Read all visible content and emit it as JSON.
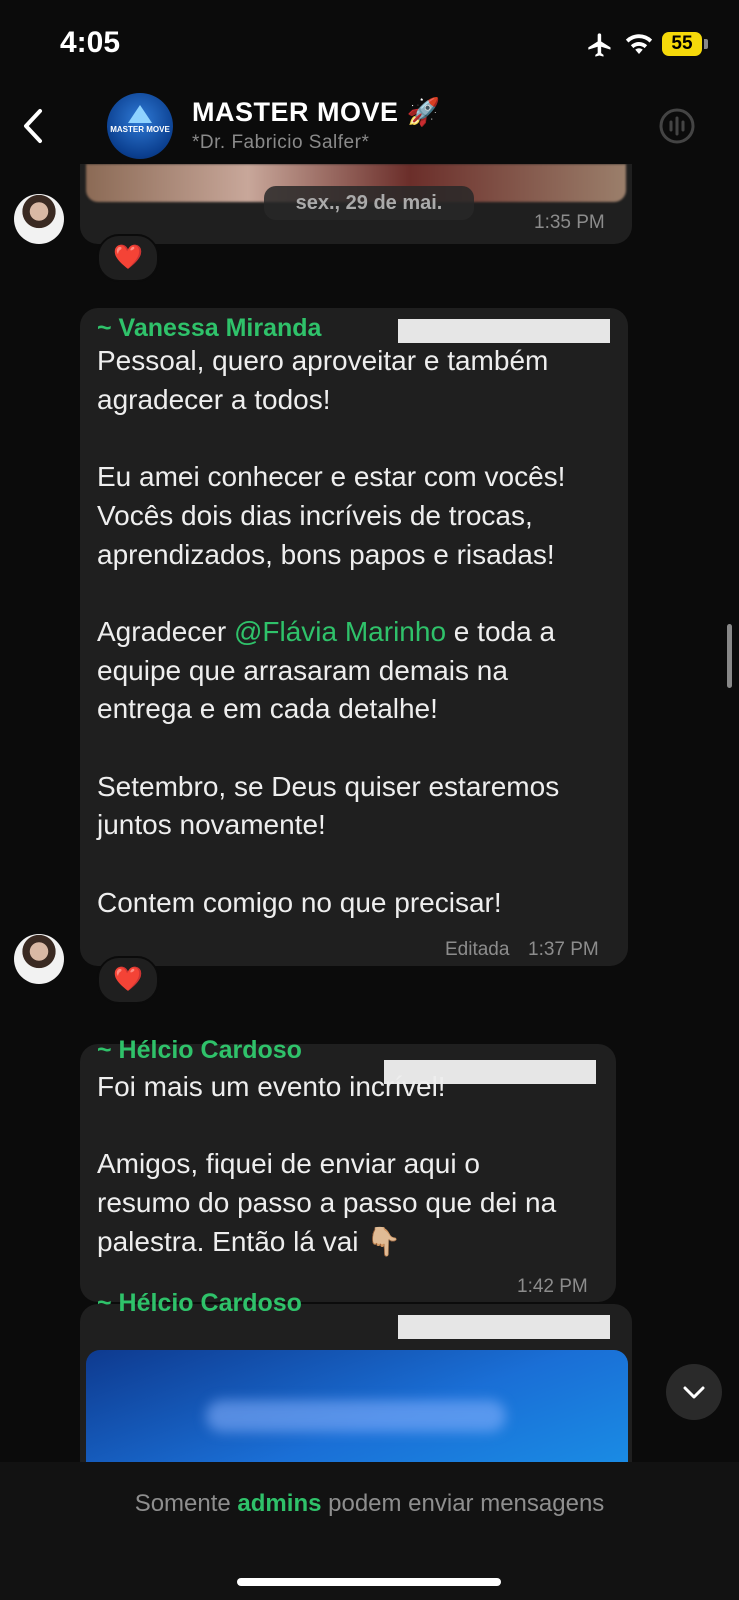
{
  "status_bar": {
    "time": "4:05",
    "battery": "55"
  },
  "header": {
    "title": "MASTER MOVE 🚀",
    "subtitle": "*Dr. Fabricio Salfer*",
    "avatar_text": "MASTER MOVE"
  },
  "messages": [
    {
      "time": "1:35 PM",
      "reaction": "❤️",
      "date_pill": "sex., 29 de mai."
    },
    {
      "sender": "~ Vanessa Miranda",
      "text_before": "Pessoal, quero aproveitar e também\nagradecer a todos!\n\nEu amei conhecer e estar com vocês!\nVocês dois dias incríveis de trocas,\naprendizados, bons papos e risadas!\n\nAgradecer ",
      "mention": "@Flávia Marinho",
      "text_after": " e toda a\nequipe que arrasaram demais na\nentrega e em cada detalhe!\n\nSetembro, se Deus quiser estaremos\njuntos novamente!\n\nContem comigo no que precisar!",
      "edited_label": "Editada",
      "time": "1:37 PM",
      "reaction": "❤️"
    },
    {
      "sender": "~ Hélcio Cardoso",
      "text": "Foi mais um evento incrível!\n\nAmigos, fiquei de enviar aqui o\nresumo do passo a passo que dei na\npalestra. Então lá vai 👇🏼",
      "time": "1:42 PM"
    },
    {
      "sender": "~ Hélcio Cardoso"
    }
  ],
  "footer": {
    "prefix": "Somente ",
    "admins": "admins",
    "suffix": " podem enviar mensagens"
  }
}
